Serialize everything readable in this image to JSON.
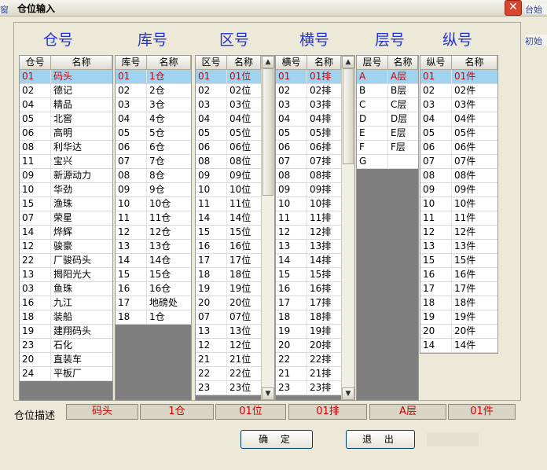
{
  "window": {
    "title": "仓位输入",
    "close_label": "✕"
  },
  "background_fragments": {
    "left": "窗",
    "right1": "台始化项",
    "right2": "初始化"
  },
  "groups": [
    {
      "title": "仓号",
      "columns": [
        "仓号",
        "名称"
      ],
      "selected": 0,
      "rows": [
        [
          "01",
          "码头"
        ],
        [
          "02",
          "德记"
        ],
        [
          "04",
          "精品"
        ],
        [
          "05",
          "北窖"
        ],
        [
          "06",
          "高明"
        ],
        [
          "08",
          "利华达"
        ],
        [
          "11",
          "宝兴"
        ],
        [
          "09",
          "新源动力"
        ],
        [
          "10",
          "华劲"
        ],
        [
          "15",
          "渔珠"
        ],
        [
          "07",
          "荣星"
        ],
        [
          "14",
          "烨辉"
        ],
        [
          "12",
          "骏豪"
        ],
        [
          "22",
          "厂骏码头"
        ],
        [
          "13",
          "揭阳光大"
        ],
        [
          "03",
          "鱼珠"
        ],
        [
          "16",
          "九江"
        ],
        [
          "18",
          "装船"
        ],
        [
          "19",
          "建翔码头"
        ],
        [
          "23",
          "石化"
        ],
        [
          "20",
          "直装车"
        ],
        [
          "24",
          "平板厂"
        ]
      ]
    },
    {
      "title": "库号",
      "columns": [
        "库号",
        "名称"
      ],
      "selected": 0,
      "rows": [
        [
          "01",
          "1仓"
        ],
        [
          "02",
          "2仓"
        ],
        [
          "03",
          "3仓"
        ],
        [
          "04",
          "4仓"
        ],
        [
          "05",
          "5仓"
        ],
        [
          "06",
          "6仓"
        ],
        [
          "07",
          "7仓"
        ],
        [
          "08",
          "8仓"
        ],
        [
          "09",
          "9仓"
        ],
        [
          "10",
          "10仓"
        ],
        [
          "11",
          "11仓"
        ],
        [
          "12",
          "12仓"
        ],
        [
          "13",
          "13仓"
        ],
        [
          "14",
          "14仓"
        ],
        [
          "15",
          "15仓"
        ],
        [
          "16",
          "16仓"
        ],
        [
          "17",
          "地磅处"
        ],
        [
          "18",
          "1仓"
        ]
      ]
    },
    {
      "title": "区号",
      "columns": [
        "区号",
        "名称"
      ],
      "selected": 0,
      "rows": [
        [
          "01",
          "01位"
        ],
        [
          "02",
          "02位"
        ],
        [
          "03",
          "03位"
        ],
        [
          "04",
          "04位"
        ],
        [
          "05",
          "05位"
        ],
        [
          "06",
          "06位"
        ],
        [
          "08",
          "08位"
        ],
        [
          "09",
          "09位"
        ],
        [
          "10",
          "10位"
        ],
        [
          "11",
          "11位"
        ],
        [
          "14",
          "14位"
        ],
        [
          "15",
          "15位"
        ],
        [
          "16",
          "16位"
        ],
        [
          "17",
          "17位"
        ],
        [
          "18",
          "18位"
        ],
        [
          "19",
          "19位"
        ],
        [
          "20",
          "20位"
        ],
        [
          "07",
          "07位"
        ],
        [
          "13",
          "13位"
        ],
        [
          "12",
          "12位"
        ],
        [
          "21",
          "21位"
        ],
        [
          "22",
          "22位"
        ],
        [
          "23",
          "23位"
        ]
      ]
    },
    {
      "title": "横号",
      "columns": [
        "横号",
        "名称"
      ],
      "selected": 0,
      "rows": [
        [
          "01",
          "01排"
        ],
        [
          "02",
          "02排"
        ],
        [
          "03",
          "03排"
        ],
        [
          "04",
          "04排"
        ],
        [
          "05",
          "05排"
        ],
        [
          "06",
          "06排"
        ],
        [
          "07",
          "07排"
        ],
        [
          "08",
          "08排"
        ],
        [
          "09",
          "09排"
        ],
        [
          "10",
          "10排"
        ],
        [
          "11",
          "11排"
        ],
        [
          "12",
          "12排"
        ],
        [
          "13",
          "13排"
        ],
        [
          "14",
          "14排"
        ],
        [
          "15",
          "15排"
        ],
        [
          "16",
          "16排"
        ],
        [
          "17",
          "17排"
        ],
        [
          "18",
          "18排"
        ],
        [
          "19",
          "19排"
        ],
        [
          "20",
          "20排"
        ],
        [
          "22",
          "22排"
        ],
        [
          "21",
          "21排"
        ],
        [
          "23",
          "23排"
        ]
      ]
    },
    {
      "title": "层号",
      "columns": [
        "层号",
        "名称"
      ],
      "selected": 0,
      "rows": [
        [
          "A",
          "A层"
        ],
        [
          "B",
          "B层"
        ],
        [
          "C",
          "C层"
        ],
        [
          "D",
          "D层"
        ],
        [
          "E",
          "E层"
        ],
        [
          "F",
          "F层"
        ],
        [
          "G",
          ""
        ]
      ]
    },
    {
      "title": "纵号",
      "columns": [
        "纵号",
        "名称"
      ],
      "selected": 0,
      "rows": [
        [
          "01",
          "01件"
        ],
        [
          "02",
          "02件"
        ],
        [
          "03",
          "03件"
        ],
        [
          "04",
          "04件"
        ],
        [
          "05",
          "05件"
        ],
        [
          "06",
          "06件"
        ],
        [
          "07",
          "07件"
        ],
        [
          "08",
          "08件"
        ],
        [
          "09",
          "09件"
        ],
        [
          "10",
          "10件"
        ],
        [
          "11",
          "11件"
        ],
        [
          "12",
          "12件"
        ],
        [
          "13",
          "13件"
        ],
        [
          "15",
          "15件"
        ],
        [
          "16",
          "16件"
        ],
        [
          "17",
          "17件"
        ],
        [
          "18",
          "18件"
        ],
        [
          "19",
          "19件"
        ],
        [
          "20",
          "20件"
        ],
        [
          "14",
          "14件"
        ]
      ]
    }
  ],
  "description": {
    "label": "仓位描述",
    "values": [
      "码头",
      "1仓",
      "01位",
      "01排",
      "A层",
      "01件"
    ]
  },
  "buttons": {
    "ok": "确 定",
    "exit": "退 出"
  },
  "colors": {
    "title_blue": "#2233d1",
    "selected_bg": "#9fd3f0",
    "selected_text": "#d10000"
  }
}
